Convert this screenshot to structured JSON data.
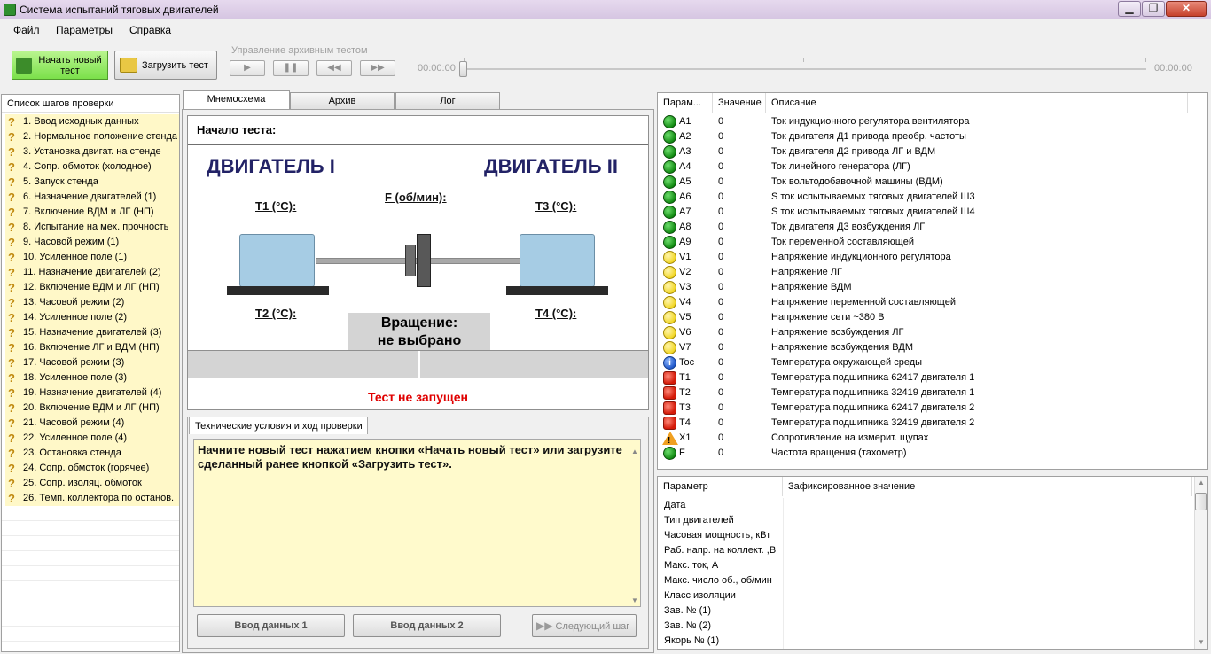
{
  "window": {
    "title": "Система испытаний тяговых двигателей"
  },
  "menu": [
    "Файл",
    "Параметры",
    "Справка"
  ],
  "toolbar": {
    "new_test": "Начать новый тест",
    "load_test": "Загрузить тест",
    "archive_caption": "Управление архивным тестом",
    "time_start": "00:00:00",
    "time_end": "00:00:00"
  },
  "steps": {
    "header": "Список шагов проверки",
    "items": [
      "1. Ввод исходных данных",
      "2. Нормальное положение стенда",
      "3. Установка двигат. на стенде",
      "4. Сопр. обмоток (холодное)",
      "5. Запуск стенда",
      "6. Назначение двигателей (1)",
      "7. Включение ВДМ и ЛГ (НП)",
      "8. Испытание на мех. прочность",
      "9. Часовой режим (1)",
      "10. Усиленное поле (1)",
      "11. Назначение двигателей (2)",
      "12. Включение ВДМ и ЛГ (НП)",
      "13. Часовой режим (2)",
      "14. Усиленное поле (2)",
      "15. Назначение двигателей (3)",
      "16. Включение ЛГ и ВДМ (НП)",
      "17. Часовой режим (3)",
      "18. Усиленное поле (3)",
      "19. Назначение двигателей (4)",
      "20. Включение ВДМ и ЛГ (НП)",
      "21. Часовой режим (4)",
      "22. Усиленное поле (4)",
      "23. Остановка стенда",
      "24. Сопр. обмоток (горячее)",
      "25. Сопр. изоляц. обмоток",
      "26. Темп. коллектора по останов."
    ]
  },
  "tabs": [
    "Мнемосхема",
    "Архив",
    "Лог"
  ],
  "mnemo": {
    "start_label": "Начало теста:",
    "engine1": "ДВИГАТЕЛЬ I",
    "engine2": "ДВИГАТЕЛЬ II",
    "t1": "T1 (°C):",
    "t2": "T2 (°C):",
    "t3": "T3 (°C):",
    "t4": "T4 (°C):",
    "f": "F (об/мин):",
    "rotation_line1": "Вращение:",
    "rotation_line2": "не выбрано",
    "status": "Тест не запущен"
  },
  "tech": {
    "tab": "Технические условия и ход проверки",
    "text": "Начните новый тест нажатием кнопки «Начать новый тест» или загрузите сделанный ранее кнопкой «Загрузить тест».",
    "btn_data1": "Ввод данных 1",
    "btn_data2": "Ввод данных 2",
    "btn_next": "Следующий шаг"
  },
  "params": {
    "headers": [
      "Парам...",
      "Значение",
      "Описание"
    ],
    "rows": [
      {
        "icon": "green",
        "name": "A1",
        "value": "0",
        "desc": "Ток индукционного регулятора вентилятора"
      },
      {
        "icon": "green",
        "name": "A2",
        "value": "0",
        "desc": "Ток двигателя Д1 привода преобр. частоты"
      },
      {
        "icon": "green",
        "name": "A3",
        "value": "0",
        "desc": "Ток двигателя Д2 привода ЛГ и ВДМ"
      },
      {
        "icon": "green",
        "name": "A4",
        "value": "0",
        "desc": "Ток линейного генератора (ЛГ)"
      },
      {
        "icon": "green",
        "name": "A5",
        "value": "0",
        "desc": "Ток вольтодобавочной машины (ВДМ)"
      },
      {
        "icon": "green",
        "name": "A6",
        "value": "0",
        "desc": "S ток испытываемых тяговых двигателей Ш3"
      },
      {
        "icon": "green",
        "name": "A7",
        "value": "0",
        "desc": "S ток испытываемых тяговых двигателей Ш4"
      },
      {
        "icon": "green",
        "name": "A8",
        "value": "0",
        "desc": "Ток двигателя Д3 возбуждения ЛГ"
      },
      {
        "icon": "green",
        "name": "A9",
        "value": "0",
        "desc": "Ток переменной составляющей"
      },
      {
        "icon": "yellow",
        "name": "V1",
        "value": "0",
        "desc": "Напряжение индукционного регулятора"
      },
      {
        "icon": "yellow",
        "name": "V2",
        "value": "0",
        "desc": "Напряжение ЛГ"
      },
      {
        "icon": "yellow",
        "name": "V3",
        "value": "0",
        "desc": "Напряжение ВДМ"
      },
      {
        "icon": "yellow",
        "name": "V4",
        "value": "0",
        "desc": "Напряжение переменной составляющей"
      },
      {
        "icon": "yellow",
        "name": "V5",
        "value": "0",
        "desc": "Напряжение сети ~380 В"
      },
      {
        "icon": "yellow",
        "name": "V6",
        "value": "0",
        "desc": "Напряжение возбуждения ЛГ"
      },
      {
        "icon": "yellow",
        "name": "V7",
        "value": "0",
        "desc": "Напряжение возбуждения ВДМ"
      },
      {
        "icon": "info",
        "name": "Toc",
        "value": "0",
        "desc": "Температура окружающей среды"
      },
      {
        "icon": "red",
        "name": "T1",
        "value": "0",
        "desc": "Температура подшипника 62417 двигателя 1"
      },
      {
        "icon": "red",
        "name": "T2",
        "value": "0",
        "desc": "Температура подшипника 32419 двигателя 1"
      },
      {
        "icon": "red",
        "name": "T3",
        "value": "0",
        "desc": "Температура подшипника 62417 двигателя 2"
      },
      {
        "icon": "red",
        "name": "T4",
        "value": "0",
        "desc": "Температура подшипника 32419 двигателя 2"
      },
      {
        "icon": "warning",
        "name": "X1",
        "value": "0",
        "desc": "Сопротивление на измерит. щупах"
      },
      {
        "icon": "green",
        "name": "F",
        "value": "0",
        "desc": "Частота вращения (тахометр)"
      }
    ]
  },
  "fixed": {
    "headers": [
      "Параметр",
      "Зафиксированное значение"
    ],
    "rows": [
      "Дата",
      "Тип двигателей",
      "Часовая мощность, кВт",
      "Раб. напр. на коллект. ,В",
      "Макс. ток, А",
      "Макс. число об., об/мин",
      "Класс изоляции",
      "Зав. № (1)",
      "Зав. № (2)",
      "Якорь № (1)"
    ]
  }
}
